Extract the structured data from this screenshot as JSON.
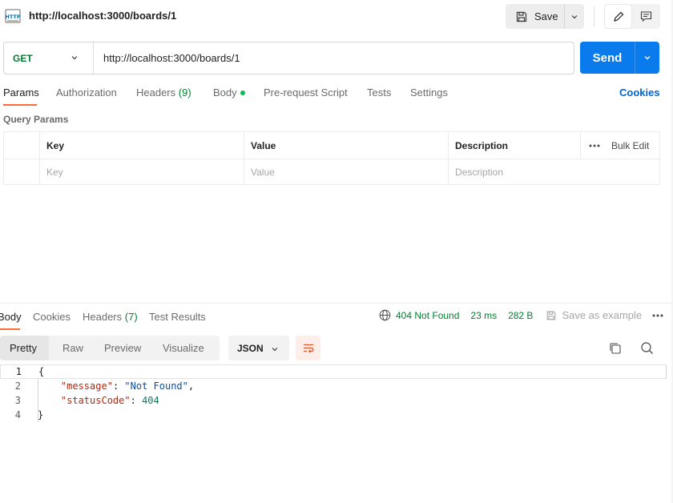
{
  "header": {
    "request_title": "http://localhost:3000/boards/1",
    "http_icon": "http-icon",
    "save_label": "Save"
  },
  "request": {
    "method": "GET",
    "url": "http://localhost:3000/boards/1",
    "send_label": "Send",
    "method_color": "#007f31",
    "send_color": "#097bed"
  },
  "tabs": {
    "params": "Params",
    "authorization": "Authorization",
    "headers": "Headers",
    "headers_count": "(9)",
    "body": "Body",
    "prerequest": "Pre-request Script",
    "tests": "Tests",
    "settings": "Settings",
    "cookies": "Cookies",
    "active_color": "#ff6c37"
  },
  "query_params": {
    "title": "Query Params",
    "columns": {
      "key": "Key",
      "value": "Value",
      "description": "Description"
    },
    "bulk_edit": "Bulk Edit",
    "placeholders": {
      "key": "Key",
      "value": "Value",
      "description": "Description"
    }
  },
  "response": {
    "tabs": {
      "body": "Body",
      "cookies": "Cookies",
      "headers": "Headers",
      "headers_count": "(7)",
      "test_results": "Test Results"
    },
    "status": "404 Not Found",
    "time": "23 ms",
    "size": "282 B",
    "save_example": "Save as example",
    "views": [
      "Pretty",
      "Raw",
      "Preview",
      "Visualize"
    ],
    "format": "JSON",
    "line_numbers": [
      "1",
      "2",
      "3",
      "4"
    ],
    "code": {
      "open": "{",
      "message_key": "\"message\"",
      "message_value": "\"Not Found\"",
      "status_key": "\"statusCode\"",
      "status_value": "404",
      "close": "}"
    }
  }
}
